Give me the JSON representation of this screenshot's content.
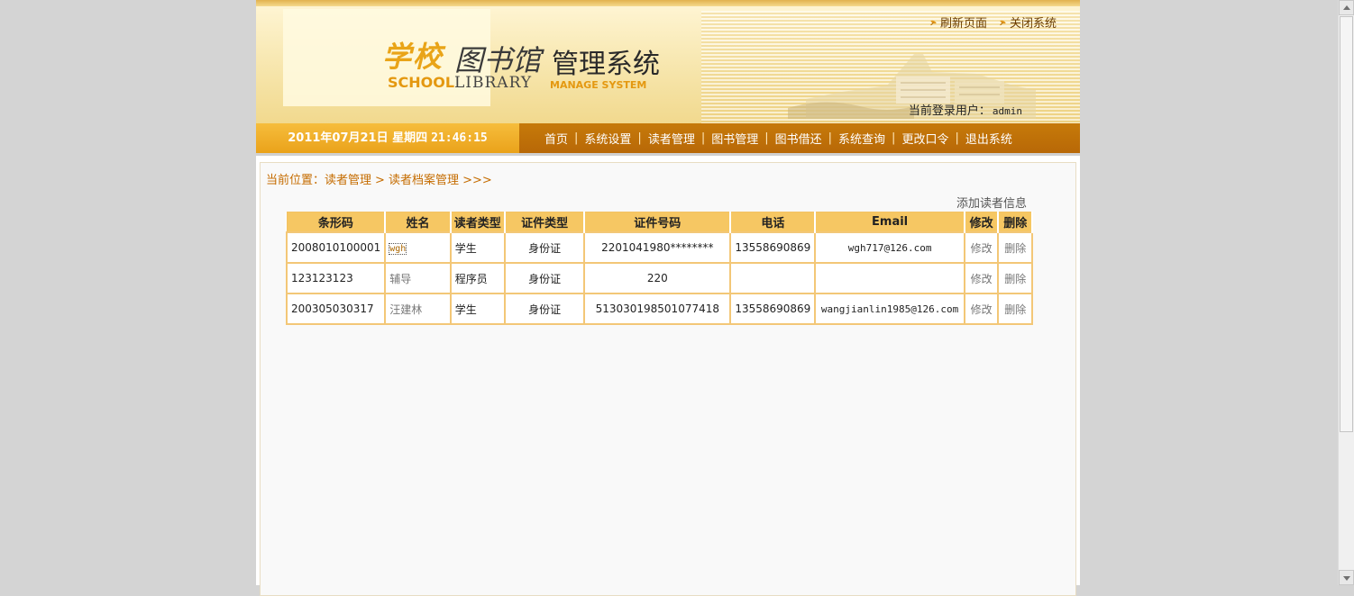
{
  "header": {
    "logo": {
      "school_cn": "学校",
      "library_cn": "图书馆",
      "manage_cn": "管理系统",
      "school_en": "SCHOOL",
      "library_en": "LIBRARY",
      "manage_en": "MANAGE SYSTEM"
    },
    "top_links": {
      "refresh": "刷新页面",
      "close": "关闭系统"
    },
    "login_label": "当前登录用户：",
    "login_user": "admin"
  },
  "navbar": {
    "date": "2011年07月21日 星期四",
    "time": "21:46:15",
    "items": [
      "首页",
      "系统设置",
      "读者管理",
      "图书管理",
      "图书借还",
      "系统查询",
      "更改口令",
      "退出系统"
    ]
  },
  "breadcrumb": {
    "label": "当前位置：",
    "level1": "读者管理",
    "sep": ">",
    "level2": "读者档案管理",
    "suffix": ">>>"
  },
  "add_link": "添加读者信息",
  "table": {
    "headers": [
      "条形码",
      "姓名",
      "读者类型",
      "证件类型",
      "证件号码",
      "电话",
      "Email",
      "修改",
      "删除"
    ],
    "rows": [
      {
        "barcode": "2008010100001",
        "name": "wgh",
        "type": "学生",
        "id_type": "身份证",
        "id_number": "2201041980********",
        "phone": "13558690869",
        "email": "wgh717@126.com",
        "edit": "修改",
        "delete": "删除"
      },
      {
        "barcode": "123123123",
        "name": "辅导",
        "type": "程序员",
        "id_type": "身份证",
        "id_number": "220",
        "phone": "",
        "email": "",
        "edit": "修改",
        "delete": "删除"
      },
      {
        "barcode": "200305030317",
        "name": "汪建林",
        "type": "学生",
        "id_type": "身份证",
        "id_number": "513030198501077418",
        "phone": "13558690869",
        "email": "wangjianlin1985@126.com",
        "edit": "修改",
        "delete": "删除"
      }
    ]
  },
  "colors": {
    "accent": "#c56c00",
    "nav_bg": "#b86807",
    "date_bg": "#eaa21a",
    "table_header": "#f6c763",
    "table_border": "#f3c777"
  },
  "icons": {
    "top_link_icon": "leaf-icon"
  }
}
